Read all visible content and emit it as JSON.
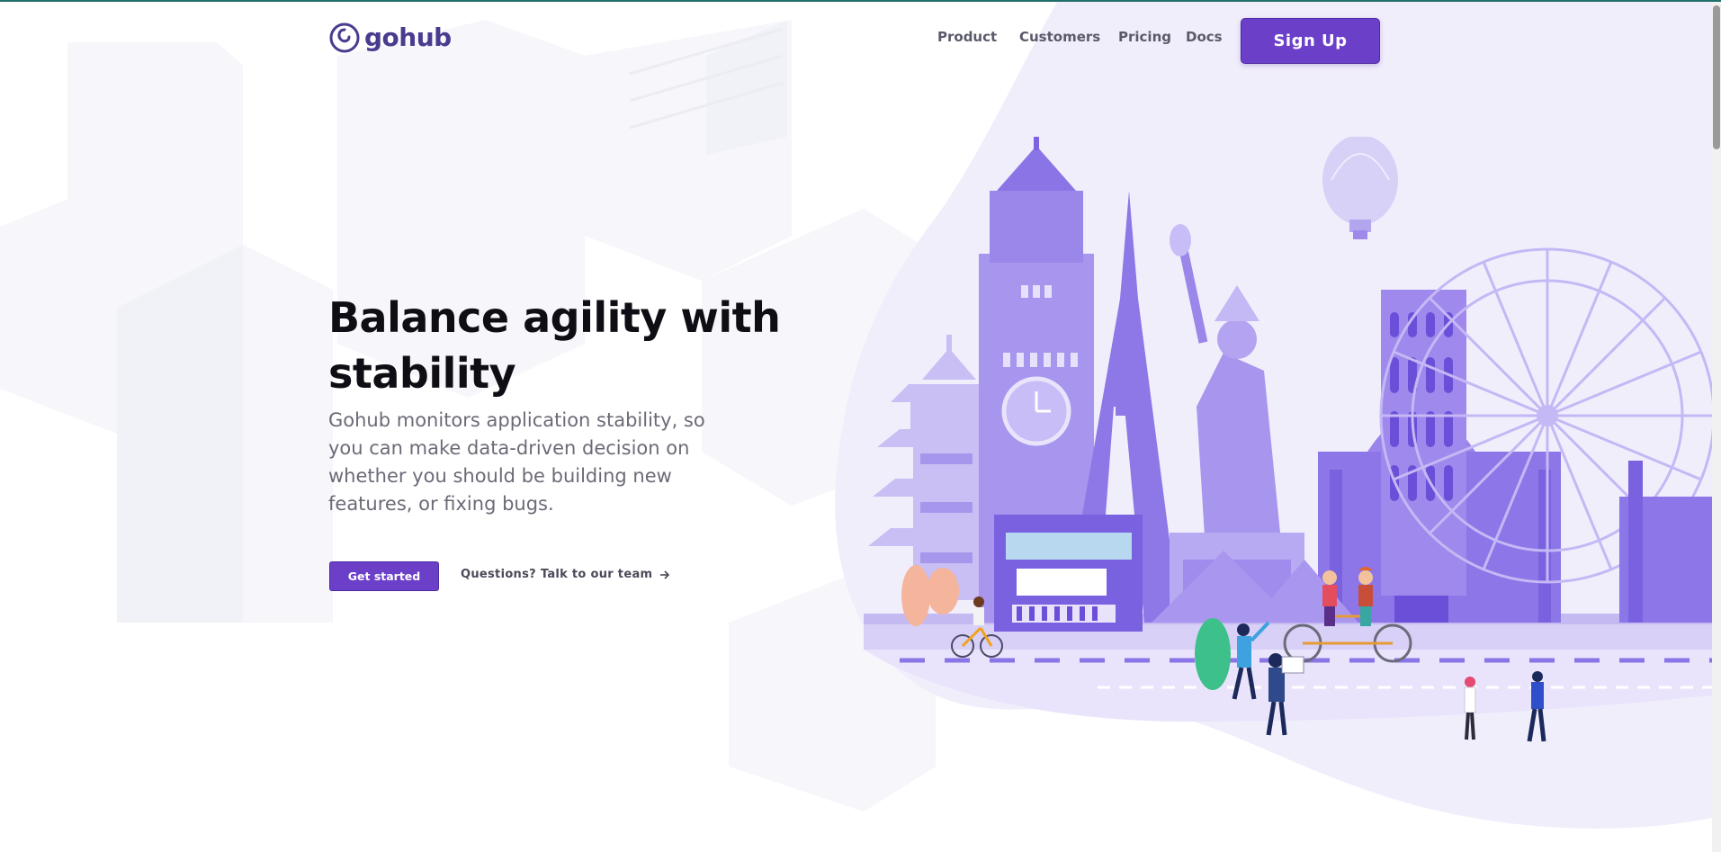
{
  "brand": {
    "name": "gohub",
    "accent": "#6c3fc9",
    "logo_color": "#4a3b8f"
  },
  "nav": {
    "items": [
      {
        "label": "Product"
      },
      {
        "label": "Customers"
      },
      {
        "label": "Pricing"
      },
      {
        "label": "Docs"
      }
    ],
    "signup_label": "Sign Up"
  },
  "hero": {
    "title": "Balance agility with stability",
    "subtitle": "Gohub monitors application stability, so you can make data-driven decision on whether you should be building new features, or fixing bugs.",
    "cta_label": "Get started",
    "talk_label": "Questions? Talk to our team",
    "talk_icon": "arrow-right-icon"
  },
  "illustration": {
    "icon": "world-landmarks-illustration"
  }
}
